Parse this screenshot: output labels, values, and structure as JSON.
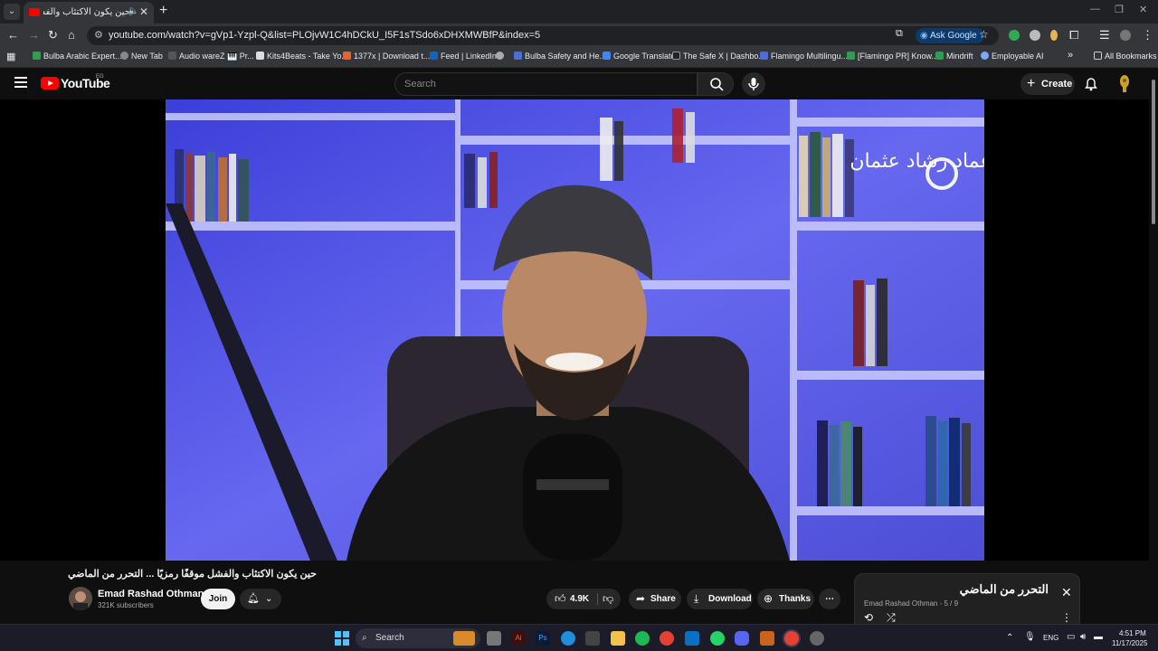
{
  "browser": {
    "tab_title": "حين يكون الاكتئاب والفشل م...",
    "url": "youtube.com/watch?v=gVp1-Yzpl-Q&list=PLOjvW1C4hDCkU_I5F1sTSdo6xDHXMWBfP&index=5",
    "ask_google": "Ask Google"
  },
  "bookmarks": [
    {
      "label": "Bulba Arabic Expert...",
      "color": "#2e9e4f"
    },
    {
      "label": "New Tab",
      "color": "#888888"
    },
    {
      "label": "Audio wareZ 🎹 Pr...",
      "color": "#555555"
    },
    {
      "label": "Kits4Beats - Take Yo...",
      "color": "#dddddd"
    },
    {
      "label": "1377x | Download t...",
      "color": "#e8622c"
    },
    {
      "label": "Feed | LinkedIn",
      "color": "#0a66c2"
    },
    {
      "label": "",
      "color": "#aaaaaa"
    },
    {
      "label": "Bulba Safety and He...",
      "color": "#4a6ee0"
    },
    {
      "label": "Google Translate",
      "color": "#4285f4"
    },
    {
      "label": "The Safe X | Dashbo...",
      "color": "#222222"
    },
    {
      "label": "Flamingo Multilingu...",
      "color": "#4a6ee0"
    },
    {
      "label": "[Flamingo PR] Know...",
      "color": "#2e9e4f"
    },
    {
      "label": "Mindrift",
      "color": "#2e9e4f"
    },
    {
      "label": "Employable AI",
      "color": "#7aa7ff"
    }
  ],
  "bookmarks_more": "»",
  "all_bookmarks": "All Bookmarks",
  "youtube": {
    "logo_text": "YouTube",
    "country_code": "EG",
    "search_placeholder": "Search",
    "create_label": "Create"
  },
  "video": {
    "watermark": "عماد رشاد عثمان",
    "title": "حين يكون الاكتئاب والفشل موقفًا رمزيًا ... التحرر من الماضي",
    "channel_name": "Emad Rashad Othman",
    "subscribers": "321K subscribers",
    "join_label": "Join",
    "likes": "4.9K",
    "share_label": "Share",
    "download_label": "Download",
    "thanks_label": "Thanks"
  },
  "playlist": {
    "title": "التحرر من الماضي",
    "owner": "Emad Rashad Othman",
    "position": "5 / 9"
  },
  "taskbar": {
    "search_label": "Search",
    "language": "ENG",
    "time": "4:51 PM",
    "date": "11/17/2025"
  }
}
